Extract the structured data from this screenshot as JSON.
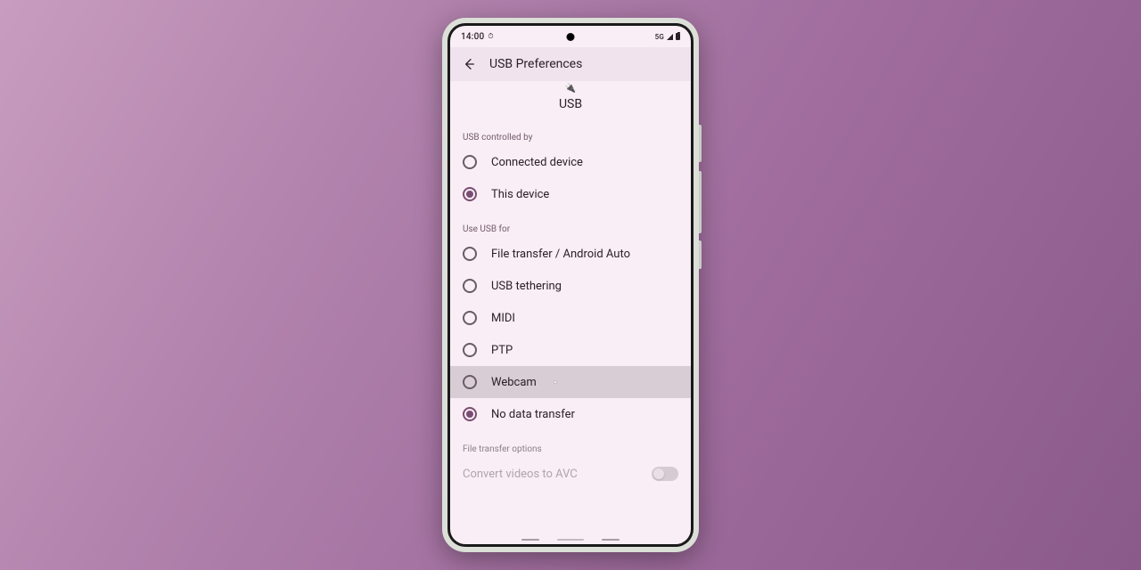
{
  "status": {
    "time": "14:00",
    "net": "5G"
  },
  "appbar": {
    "title": "USB Preferences"
  },
  "header": {
    "title": "USB"
  },
  "sections": {
    "control": {
      "label": "USB controlled by",
      "opt0": "Connected device",
      "opt1": "This device"
    },
    "usefor": {
      "label": "Use USB for",
      "opt0": "File transfer / Android Auto",
      "opt1": "USB tethering",
      "opt2": "MIDI",
      "opt3": "PTP",
      "opt4": "Webcam",
      "opt5": "No data transfer"
    },
    "fileopts": {
      "label": "File transfer options",
      "avc": "Convert videos to AVC"
    }
  }
}
